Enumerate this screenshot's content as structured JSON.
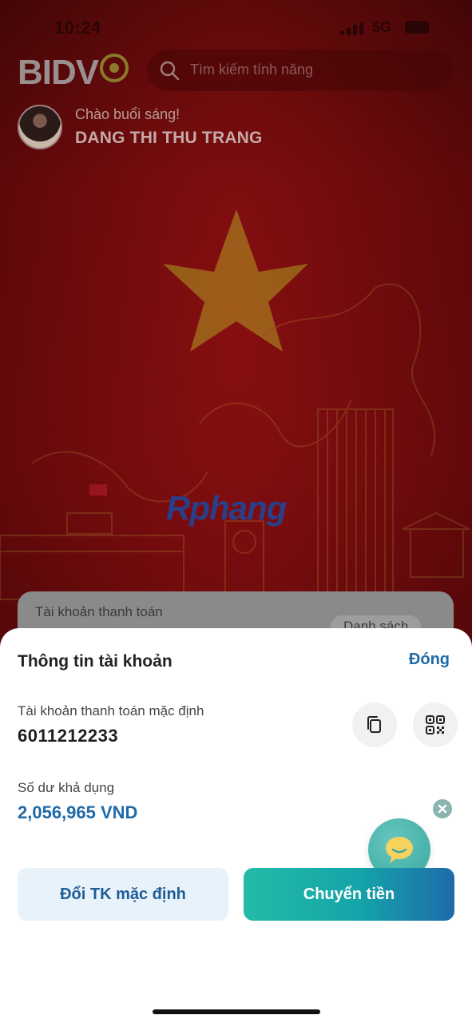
{
  "status_bar": {
    "time": "10:24",
    "network": "5G"
  },
  "header": {
    "logo_text": "BIDV",
    "search_placeholder": "Tìm kiếm tính năng"
  },
  "profile": {
    "greeting": "Chào buổi sáng!",
    "name": "DANG THI THU TRANG"
  },
  "watermark": "Rphang",
  "underlay_card": {
    "title": "Tài khoản thanh toán",
    "list_button": "Danh sách"
  },
  "sheet": {
    "title": "Thông tin tài khoản",
    "close_label": "Đóng",
    "account_label": "Tài khoản thanh toán mặc định",
    "account_number": "6011212233",
    "balance_label": "Số dư khả dụng",
    "balance_value": "2,056,965 VND",
    "change_default_button": "Đổi TK mặc định",
    "transfer_button": "Chuyển tiền"
  },
  "colors": {
    "brand_blue": "#1f6aa8",
    "transfer_gradient_start": "#23bba8",
    "transfer_gradient_end": "#1e6bab",
    "background_red": "#820c0e",
    "star_gold": "#c9a227"
  },
  "icons": [
    "search-icon",
    "copy-icon",
    "qr-code-icon",
    "chat-icon",
    "close-icon",
    "signal-icon",
    "battery-icon"
  ]
}
